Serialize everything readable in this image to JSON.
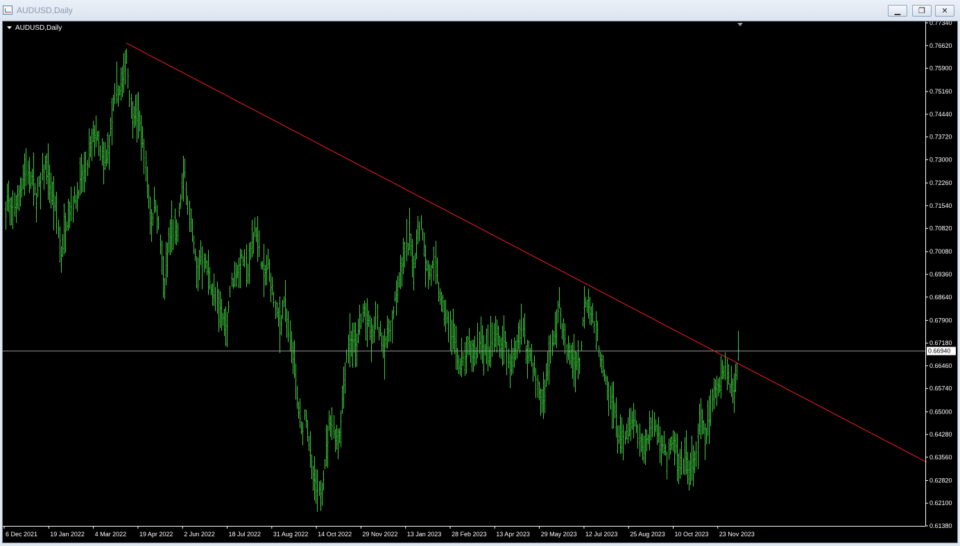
{
  "window": {
    "title": "AUDUSD,Daily",
    "minimize_label": "▁",
    "maximize_label": "❐",
    "close_label": "✕"
  },
  "chart_label": "AUDUSD,Daily",
  "colors": {
    "background": "#000000",
    "bars": "#3fd13f",
    "trendline": "#ff2020",
    "price_line": "#9a9a9a",
    "axis_text": "#ffffff"
  },
  "current_price": "0.66940",
  "chart_data": {
    "type": "bar",
    "title": "AUDUSD,Daily",
    "xlabel": "",
    "ylabel": "",
    "ylim": [
      0.6138,
      0.7734
    ],
    "yticks": [
      "0.77340",
      "0.76620",
      "0.75900",
      "0.75160",
      "0.74440",
      "0.73720",
      "0.73000",
      "0.72260",
      "0.71540",
      "0.70820",
      "0.70080",
      "0.69360",
      "0.68640",
      "0.67900",
      "0.67180",
      "0.66460",
      "0.65740",
      "0.65000",
      "0.64280",
      "0.63560",
      "0.62820",
      "0.62100",
      "0.61380"
    ],
    "xticks": [
      "6 Dec 2021",
      "19 Jan 2022",
      "4 Mar 2022",
      "19 Apr 2022",
      "2 Jun 2022",
      "18 Jul 2022",
      "31 Aug 2022",
      "14 Oct 2022",
      "29 Nov 2022",
      "13 Jan 2023",
      "28 Feb 2023",
      "13 Apr 2023",
      "29 May 2023",
      "12 Jul 2023",
      "25 Aug 2023",
      "10 Oct 2023",
      "23 Nov 2023"
    ],
    "series": [
      {
        "values": [
          [
            0,
            0.706
          ],
          [
            6,
            0.718
          ],
          [
            12,
            0.713
          ],
          [
            18,
            0.716
          ],
          [
            24,
            0.72
          ],
          [
            30,
            0.725
          ],
          [
            36,
            0.727
          ],
          [
            42,
            0.724
          ],
          [
            48,
            0.718
          ],
          [
            54,
            0.722
          ],
          [
            60,
            0.729
          ],
          [
            66,
            0.723
          ],
          [
            72,
            0.717
          ],
          [
            78,
            0.711
          ],
          [
            84,
            0.7
          ],
          [
            90,
            0.709
          ],
          [
            96,
            0.714
          ],
          [
            102,
            0.717
          ],
          [
            108,
            0.72
          ],
          [
            114,
            0.724
          ],
          [
            120,
            0.727
          ],
          [
            126,
            0.733
          ],
          [
            132,
            0.739
          ],
          [
            138,
            0.735
          ],
          [
            144,
            0.728
          ],
          [
            150,
            0.73
          ],
          [
            156,
            0.74
          ],
          [
            162,
            0.75
          ],
          [
            168,
            0.752
          ],
          [
            174,
            0.756
          ],
          [
            178,
            0.764
          ],
          [
            184,
            0.747
          ],
          [
            190,
            0.745
          ],
          [
            196,
            0.742
          ],
          [
            202,
            0.736
          ],
          [
            208,
            0.722
          ],
          [
            214,
            0.71
          ],
          [
            220,
            0.718
          ],
          [
            226,
            0.705
          ],
          [
            232,
            0.688
          ],
          [
            238,
            0.702
          ],
          [
            244,
            0.708
          ],
          [
            250,
            0.704
          ],
          [
            256,
            0.718
          ],
          [
            262,
            0.726
          ],
          [
            268,
            0.715
          ],
          [
            274,
            0.704
          ],
          [
            280,
            0.694
          ],
          [
            286,
            0.7
          ],
          [
            292,
            0.696
          ],
          [
            298,
            0.692
          ],
          [
            304,
            0.686
          ],
          [
            310,
            0.684
          ],
          [
            316,
            0.68
          ],
          [
            322,
            0.676
          ],
          [
            328,
            0.69
          ],
          [
            334,
            0.693
          ],
          [
            340,
            0.696
          ],
          [
            346,
            0.699
          ],
          [
            352,
            0.694
          ],
          [
            358,
            0.702
          ],
          [
            364,
            0.709
          ],
          [
            370,
            0.7
          ],
          [
            376,
            0.693
          ],
          [
            382,
            0.696
          ],
          [
            388,
            0.689
          ],
          [
            394,
            0.68
          ],
          [
            400,
            0.678
          ],
          [
            406,
            0.687
          ],
          [
            412,
            0.672
          ],
          [
            418,
            0.668
          ],
          [
            424,
            0.654
          ],
          [
            430,
            0.643
          ],
          [
            436,
            0.65
          ],
          [
            442,
            0.638
          ],
          [
            448,
            0.627
          ],
          [
            454,
            0.623
          ],
          [
            460,
            0.627
          ],
          [
            466,
            0.638
          ],
          [
            472,
            0.648
          ],
          [
            478,
            0.643
          ],
          [
            484,
            0.641
          ],
          [
            490,
            0.656
          ],
          [
            496,
            0.67
          ],
          [
            502,
            0.674
          ],
          [
            508,
            0.67
          ],
          [
            514,
            0.676
          ],
          [
            520,
            0.683
          ],
          [
            526,
            0.678
          ],
          [
            532,
            0.672
          ],
          [
            538,
            0.68
          ],
          [
            544,
            0.674
          ],
          [
            550,
            0.67
          ],
          [
            556,
            0.676
          ],
          [
            562,
            0.68
          ],
          [
            568,
            0.69
          ],
          [
            574,
            0.695
          ],
          [
            580,
            0.7
          ],
          [
            586,
            0.705
          ],
          [
            592,
            0.696
          ],
          [
            598,
            0.708
          ],
          [
            604,
            0.71
          ],
          [
            610,
            0.696
          ],
          [
            616,
            0.693
          ],
          [
            622,
            0.698
          ],
          [
            628,
            0.688
          ],
          [
            634,
            0.683
          ],
          [
            640,
            0.679
          ],
          [
            646,
            0.674
          ],
          [
            652,
            0.672
          ],
          [
            658,
            0.663
          ],
          [
            664,
            0.666
          ],
          [
            670,
            0.67
          ],
          [
            676,
            0.668
          ],
          [
            682,
            0.668
          ],
          [
            688,
            0.674
          ],
          [
            694,
            0.67
          ],
          [
            700,
            0.668
          ],
          [
            706,
            0.672
          ],
          [
            712,
            0.675
          ],
          [
            718,
            0.67
          ],
          [
            724,
            0.672
          ],
          [
            730,
            0.664
          ],
          [
            736,
            0.666
          ],
          [
            742,
            0.672
          ],
          [
            748,
            0.677
          ],
          [
            754,
            0.67
          ],
          [
            760,
            0.668
          ],
          [
            766,
            0.663
          ],
          [
            772,
            0.657
          ],
          [
            778,
            0.652
          ],
          [
            784,
            0.662
          ],
          [
            790,
            0.669
          ],
          [
            796,
            0.676
          ],
          [
            802,
            0.684
          ],
          [
            808,
            0.675
          ],
          [
            814,
            0.668
          ],
          [
            820,
            0.668
          ],
          [
            826,
            0.666
          ],
          [
            832,
            0.666
          ],
          [
            838,
            0.686
          ],
          [
            844,
            0.684
          ],
          [
            850,
            0.68
          ],
          [
            856,
            0.676
          ],
          [
            862,
            0.666
          ],
          [
            868,
            0.66
          ],
          [
            874,
            0.654
          ],
          [
            880,
            0.653
          ],
          [
            886,
            0.644
          ],
          [
            892,
            0.64
          ],
          [
            898,
            0.642
          ],
          [
            904,
            0.646
          ],
          [
            910,
            0.647
          ],
          [
            916,
            0.642
          ],
          [
            922,
            0.638
          ],
          [
            928,
            0.641
          ],
          [
            934,
            0.646
          ],
          [
            940,
            0.645
          ],
          [
            946,
            0.642
          ],
          [
            952,
            0.64
          ],
          [
            958,
            0.635
          ],
          [
            964,
            0.64
          ],
          [
            970,
            0.638
          ],
          [
            976,
            0.63
          ],
          [
            982,
            0.634
          ],
          [
            988,
            0.633
          ],
          [
            994,
            0.633
          ],
          [
            1000,
            0.638
          ],
          [
            1006,
            0.648
          ],
          [
            1012,
            0.64
          ],
          [
            1018,
            0.648
          ],
          [
            1024,
            0.656
          ],
          [
            1030,
            0.658
          ],
          [
            1036,
            0.662
          ],
          [
            1042,
            0.664
          ],
          [
            1048,
            0.658
          ],
          [
            1054,
            0.657
          ],
          [
            1060,
            0.668
          ],
          [
            1062,
            0.67
          ]
        ]
      }
    ],
    "trendline": {
      "from": [
        178,
        0.767
      ],
      "to": [
        1332,
        0.634
      ]
    },
    "grid": false
  }
}
